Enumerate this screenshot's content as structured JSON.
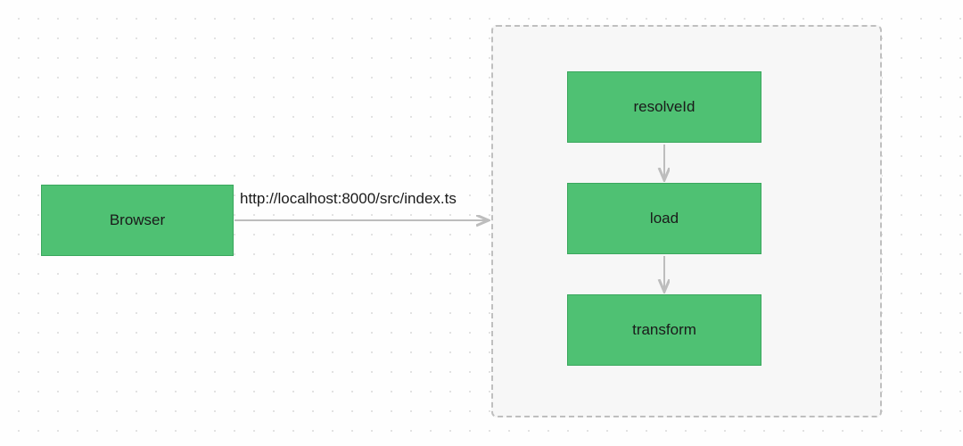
{
  "diagram": {
    "browser_label": "Browser",
    "request_url": "http://localhost:8000/src/index.ts",
    "hooks": {
      "resolve": "resolveId",
      "load": "load",
      "transform": "transform"
    }
  },
  "colors": {
    "node_fill": "#4fc173",
    "node_border": "#3aa75d",
    "arrow": "#bdbdbd",
    "group_bg": "#f7f7f7",
    "group_border": "#bfbfbf"
  }
}
